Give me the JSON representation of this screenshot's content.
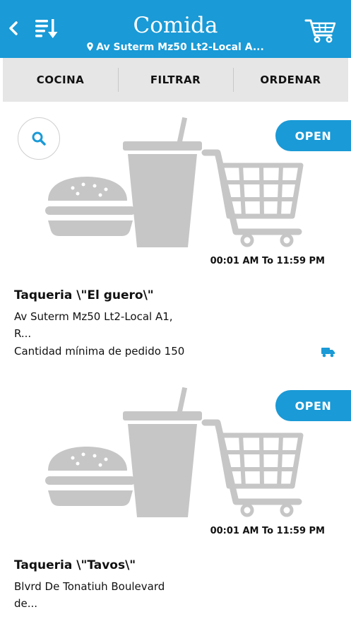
{
  "header": {
    "title": "Comida",
    "address": "Av Suterm Mz50 Lt2-Local A...",
    "color": "#1a9ad6",
    "icons": {
      "back": "chevron-left-icon",
      "sort": "sort-list-icon",
      "cart": "shopping-cart-icon",
      "location": "map-pin-icon"
    }
  },
  "menu": {
    "items": [
      {
        "label": "COCINA"
      },
      {
        "label": "FILTRAR"
      },
      {
        "label": "ORDENAR"
      }
    ]
  },
  "search": {
    "icon": "search-icon"
  },
  "restaurants": [
    {
      "status": "OPEN",
      "hours": "00:01 AM To 11:59 PM",
      "name": "Taqueria \\\"El guero\\\"",
      "address_line1": "Av Suterm Mz50 Lt2-Local A1,",
      "address_line2": "R...",
      "minimum": "Cantidad mínima de pedido 150",
      "delivery_icon": "truck-icon"
    },
    {
      "status": "OPEN",
      "hours": "00:01 AM To 11:59 PM",
      "name": "Taqueria \\\"Tavos\\\"",
      "address_line1": "Blvrd De Tonatiuh Boulevard",
      "address_line2": "de..."
    }
  ]
}
